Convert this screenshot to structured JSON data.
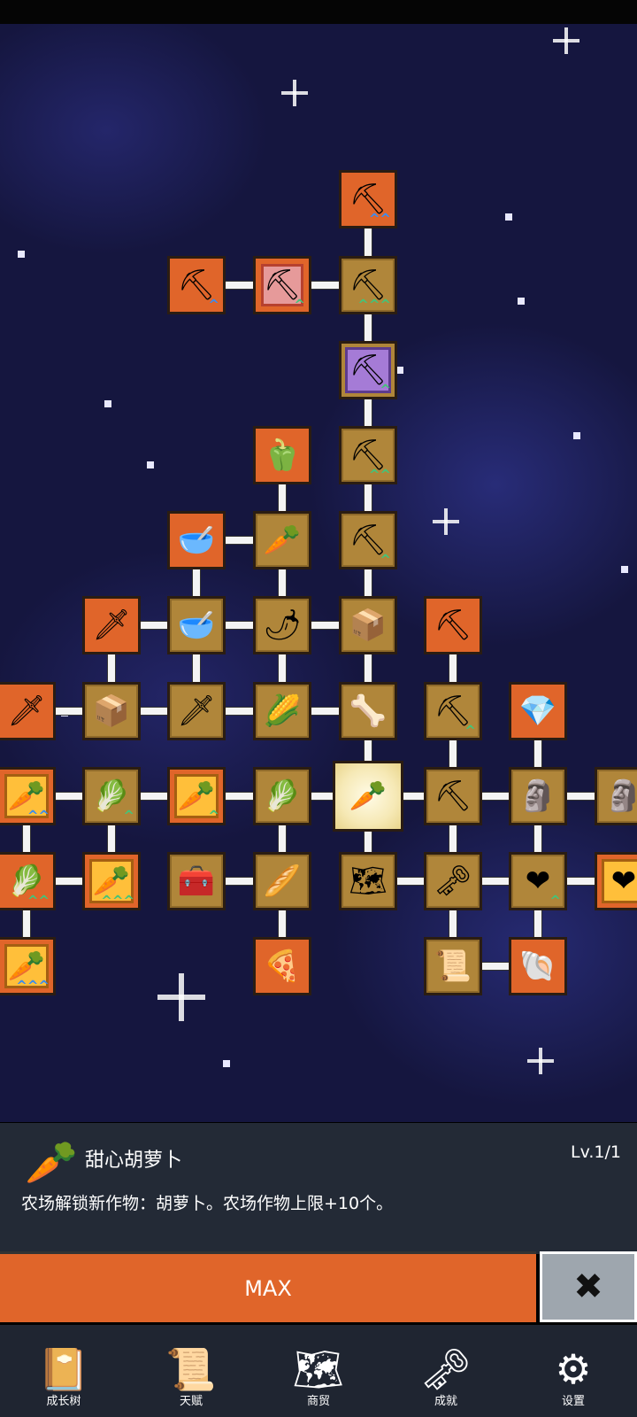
{
  "tree": {
    "nodes": [
      {
        "name": "shovel-node",
        "icon": "⛏",
        "style": "orange",
        "up": "^^",
        "upColor": "blue"
      },
      {
        "name": "shovel-node",
        "icon": "⛏",
        "style": "orange",
        "up": "^",
        "upColor": "blue"
      },
      {
        "name": "shovel-node",
        "icon": "⛏",
        "style": "pink",
        "up": "^",
        "upColor": "green"
      },
      {
        "name": "shovel-node",
        "icon": "⛏",
        "style": "tan",
        "up": "^^^",
        "upColor": "green"
      },
      {
        "name": "shovel-node",
        "icon": "⛏",
        "style": "purple",
        "up": "^",
        "upColor": "green"
      },
      {
        "name": "bell-pepper-node",
        "icon": "🫑",
        "style": "orange",
        "up": "",
        "upColor": "green"
      },
      {
        "name": "shovel-node",
        "icon": "⛏",
        "style": "tan",
        "up": "^^",
        "upColor": "green"
      },
      {
        "name": "wooden-bowl-node",
        "icon": "🥣",
        "style": "orange",
        "up": "",
        "upColor": "green"
      },
      {
        "name": "radish-node",
        "icon": "🥕",
        "style": "tan",
        "up": "",
        "upColor": "green"
      },
      {
        "name": "shovel-node",
        "icon": "⛏",
        "style": "tan",
        "up": "^",
        "upColor": "green"
      },
      {
        "name": "golden-sword-node",
        "icon": "🗡",
        "style": "orange",
        "up": "",
        "upColor": "green"
      },
      {
        "name": "wooden-bowl-node",
        "icon": "🥣",
        "style": "tan",
        "up": "",
        "upColor": "green"
      },
      {
        "name": "chili-node",
        "icon": "🌶",
        "style": "tan",
        "up": "",
        "upColor": "green"
      },
      {
        "name": "crate-node",
        "icon": "📦",
        "style": "tan",
        "up": "",
        "upColor": "green"
      },
      {
        "name": "pickaxe-node",
        "icon": "⛏",
        "style": "orange",
        "up": "",
        "upColor": "green"
      },
      {
        "name": "sword-node",
        "icon": "🗡",
        "style": "orange",
        "up": "",
        "upColor": "green"
      },
      {
        "name": "crate-node",
        "icon": "📦",
        "style": "tan",
        "up": "",
        "upColor": "green"
      },
      {
        "name": "sword-node",
        "icon": "🗡",
        "style": "tan",
        "up": "",
        "upColor": "green"
      },
      {
        "name": "corn-node",
        "icon": "🌽",
        "style": "tan",
        "up": "",
        "upColor": "green"
      },
      {
        "name": "branch-node",
        "icon": "🦴",
        "style": "tan",
        "up": "",
        "upColor": "green"
      },
      {
        "name": "pickaxe-node",
        "icon": "⛏",
        "style": "tan",
        "up": "^",
        "upColor": "green"
      },
      {
        "name": "crystal-node",
        "icon": "💎",
        "style": "orange",
        "up": "",
        "upColor": "green"
      },
      {
        "name": "carrot-node",
        "icon": "🥕",
        "style": "gold",
        "up": "^^",
        "upColor": "blue"
      },
      {
        "name": "cabbage-node",
        "icon": "🥬",
        "style": "tan",
        "up": "^",
        "upColor": "green"
      },
      {
        "name": "carrot-node",
        "icon": "🥕",
        "style": "gold",
        "up": "^",
        "upColor": "green"
      },
      {
        "name": "cabbage-node",
        "icon": "🥬",
        "style": "tan",
        "up": "",
        "upColor": "green"
      },
      {
        "name": "sweet-carrot-node",
        "icon": "🥕",
        "style": "selected",
        "up": "",
        "upColor": "green"
      },
      {
        "name": "pickaxe-node",
        "icon": "⛏",
        "style": "tan",
        "up": "",
        "upColor": "green"
      },
      {
        "name": "statue-node",
        "icon": "🗿",
        "style": "tan",
        "up": "",
        "upColor": "green"
      },
      {
        "name": "statue-node",
        "icon": "🗿",
        "style": "tan",
        "up": "",
        "upColor": "green"
      },
      {
        "name": "cabbage-node",
        "icon": "🥬",
        "style": "orange",
        "up": "^^",
        "upColor": "green"
      },
      {
        "name": "carrot-node",
        "icon": "🥕",
        "style": "gold",
        "up": "^^^",
        "upColor": "green"
      },
      {
        "name": "chest-node",
        "icon": "🧰",
        "style": "tan",
        "up": "",
        "upColor": "green"
      },
      {
        "name": "parsnip-node",
        "icon": "🥖",
        "style": "tan",
        "up": "",
        "upColor": "green"
      },
      {
        "name": "map-node",
        "icon": "🗺",
        "style": "tan",
        "up": "",
        "upColor": "green"
      },
      {
        "name": "key-node",
        "icon": "🗝",
        "style": "tan",
        "up": "",
        "upColor": "green"
      },
      {
        "name": "heart-node",
        "icon": "❤",
        "style": "tan",
        "up": "^",
        "upColor": "green"
      },
      {
        "name": "heart-node",
        "icon": "❤",
        "style": "gold",
        "up": "",
        "upColor": "green"
      },
      {
        "name": "carrot-node",
        "icon": "🥕",
        "style": "gold",
        "up": "^^^",
        "upColor": "blue"
      },
      {
        "name": "pizza-node",
        "icon": "🍕",
        "style": "orange",
        "up": "",
        "upColor": "green"
      },
      {
        "name": "scroll-node",
        "icon": "📜",
        "style": "tan",
        "up": "",
        "upColor": "green"
      },
      {
        "name": "fossil-node",
        "icon": "🐚",
        "style": "orange",
        "up": "",
        "upColor": "green"
      }
    ]
  },
  "detail": {
    "icon": "🥕",
    "name": "甜心胡萝卜",
    "level": "Lv.1/1",
    "description": "农场解锁新作物：胡萝卜。农场作物上限+10个。",
    "max_label": "MAX",
    "close_icon": "✖"
  },
  "nav": {
    "items": [
      {
        "label": "成长树",
        "icon": "📔"
      },
      {
        "label": "天赋",
        "icon": "📜"
      },
      {
        "label": "商贸",
        "icon": "🗺"
      },
      {
        "label": "成就",
        "icon": "🗝"
      },
      {
        "label": "设置",
        "icon": "⚙"
      }
    ]
  },
  "colors": {
    "accent_orange": "#e0652a",
    "tile_tan": "#b0863a",
    "panel_bg": "#232a36",
    "close_bg": "#9ea6ae",
    "space_bg": "#15163f"
  }
}
